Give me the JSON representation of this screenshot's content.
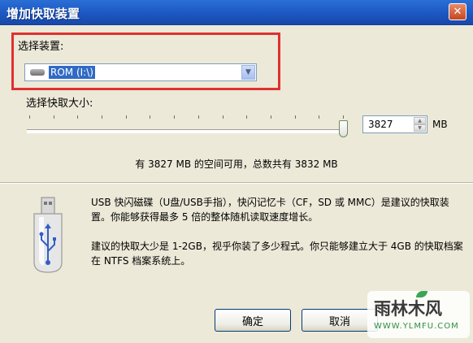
{
  "window": {
    "title": "增加快取装置",
    "close_symbol": "✕"
  },
  "device": {
    "label": "选择装置:",
    "selected": "ROM (I:\\)",
    "icon": "drive-icon"
  },
  "cache_size": {
    "label": "选择快取大小:",
    "value": "3827",
    "unit": "MB",
    "slider_fraction": 0.9988
  },
  "space_info": "有 3827 MB 的空间可用，总数共有 3832 MB",
  "info": {
    "icon": "usb-drive-icon",
    "recommend_text": "USB 快闪磁碟（U盘/USB手指），快闪记忆卡（CF，SD 或 MMC）是建议的快取装置。你能够获得最多 5 倍的整体随机读取速度增长。",
    "size_advice": "建议的快取大少是 1-2GB，视乎你装了多少程式。你只能够建立大于 4GB 的快取档案在 NTFS 档案系统上。"
  },
  "buttons": {
    "ok": "确定",
    "cancel": "取消"
  },
  "watermark": {
    "logo_text": "雨林木风",
    "url": "WWW.YLMFU.COM"
  },
  "colors": {
    "titlebar": "#1d58c2",
    "highlight_box": "#e03030",
    "selection": "#316ac5",
    "dialog_bg": "#ece9d8"
  }
}
